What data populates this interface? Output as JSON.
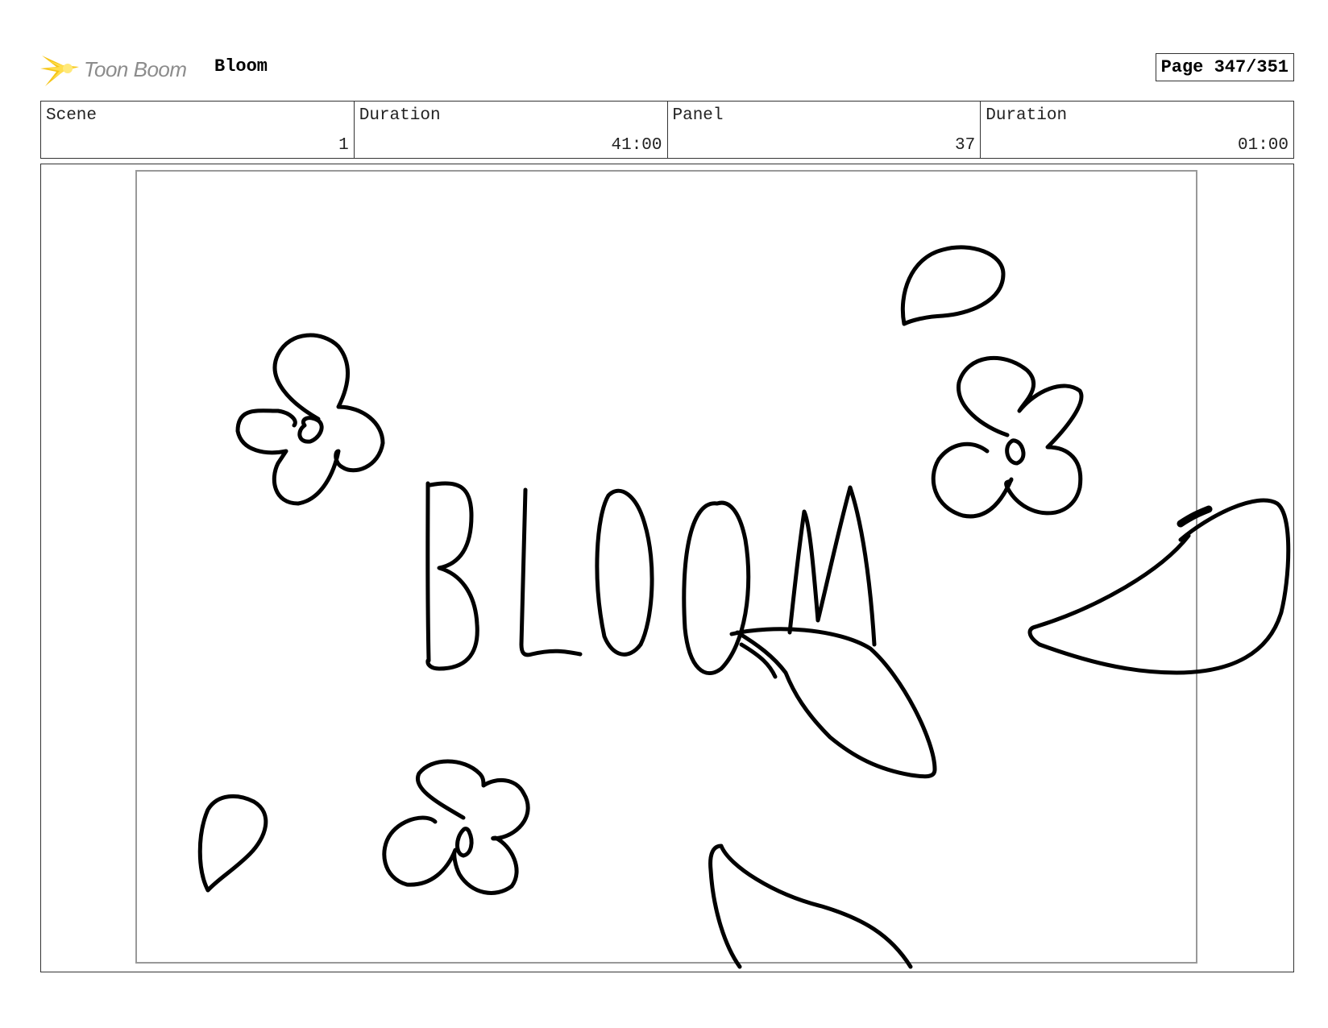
{
  "header": {
    "logo_text": "Toon Boom",
    "project_title": "Bloom",
    "page_label": "Page 347/351"
  },
  "info": [
    {
      "label": "Scene",
      "value": "1"
    },
    {
      "label": "Duration",
      "value": "41:00"
    },
    {
      "label": "Panel",
      "value": "37"
    },
    {
      "label": "Duration",
      "value": "01:00"
    }
  ],
  "panel": {
    "drawing_text": "BLOOM"
  }
}
